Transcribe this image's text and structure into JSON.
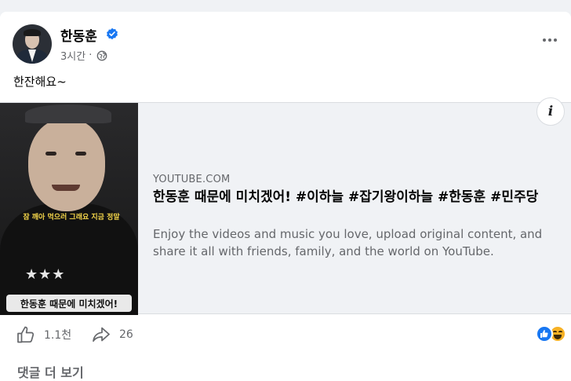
{
  "post": {
    "author": "한동훈",
    "time": "3시간",
    "separator": "·",
    "text": "한잔해요~"
  },
  "link_preview": {
    "domain": "YOUTUBE.COM",
    "title": "한동훈 때문에 미치겠어! #이하늘 #잡기왕이하늘 #한동훈 #민주당",
    "description": "Enjoy the videos and music you love, upload original content, and share it all with friends, family, and the world on YouTube.",
    "thumbnail_caption_top": "잠 깨아 먹으러 그래요 지금 정말",
    "thumbnail_caption_bottom": "한동훈 때문에 미치겠어!",
    "thumbnail_stars": "★★★",
    "info_label": "i"
  },
  "actions": {
    "like_count": "1.1천",
    "share_count": "26"
  },
  "reactions": [
    "like",
    "haha"
  ],
  "comments": {
    "more_label": "댓글 더 보기"
  },
  "colors": {
    "verified": "#1877f2",
    "secondary_text": "#65676b",
    "preview_bg": "#f0f2f5"
  }
}
